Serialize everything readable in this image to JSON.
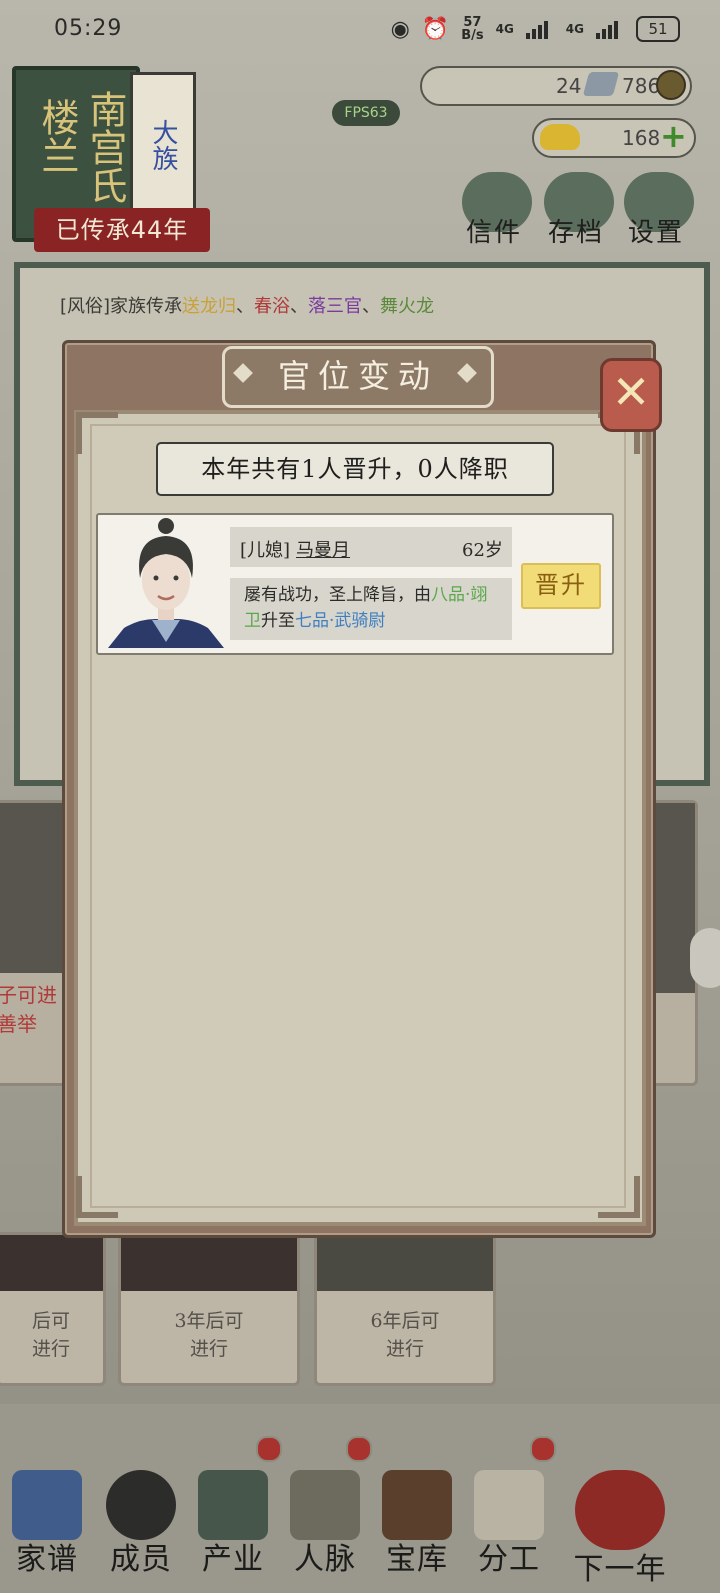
{
  "status_bar": {
    "time": "05:29",
    "net_speed_top": "57",
    "net_speed_unit": "B/s",
    "network_1": "4G",
    "network_2": "4G",
    "battery": "51"
  },
  "clan": {
    "book_left": "楼兰",
    "book_main": "南宫氏",
    "book_badge": "大族",
    "inheritance": "已传承44年"
  },
  "fps": "FPS63",
  "resources": {
    "item_count": "24",
    "coins": "786",
    "gold_ingot": "168"
  },
  "top_menu": [
    {
      "label": "信件"
    },
    {
      "label": "存档"
    },
    {
      "label": "设置"
    }
  ],
  "news": {
    "line1_prefix": "[风俗]家族传承",
    "customs": [
      "送龙归",
      "春浴",
      "落三官",
      "舞火龙"
    ],
    "customs_colors": [
      "#c9a136",
      "#b03a3a",
      "#7a3aa0",
      "#5a8a3a"
    ],
    "separator": "、"
  },
  "background_cards": {
    "side_left_text_1": "子可进",
    "side_left_text_2": "善举",
    "bottom": [
      {
        "line1": "后可",
        "line2": "进行"
      },
      {
        "line1": "3年后可",
        "line2": "进行"
      },
      {
        "line1": "6年后可",
        "line2": "进行"
      }
    ]
  },
  "bottom_nav": [
    {
      "label": "家谱"
    },
    {
      "label": "成员"
    },
    {
      "label": "产业"
    },
    {
      "label": "人脉"
    },
    {
      "label": "宝库"
    },
    {
      "label": "分工"
    },
    {
      "label": "下一年"
    }
  ],
  "modal": {
    "title": "官位变动",
    "summary": "本年共有1人晋升，0人降职",
    "records": [
      {
        "role_tag": "[儿媳]",
        "name": "马曼月",
        "age": "62岁",
        "desc_prefix": "屡有战功，圣上降旨，由",
        "from_rank": "八品·翊卫",
        "desc_mid": "升至",
        "to_rank": "七品·武骑尉",
        "from_color": "#5aa84a",
        "to_color": "#3f7fc0",
        "status": "晋升"
      }
    ]
  },
  "icons": {
    "close": "close-icon",
    "gold": "gold-ingot-icon",
    "silver": "silver-ingot-icon",
    "coin": "coin-icon",
    "plus": "plus-icon",
    "eye": "eye-icon",
    "alarm": "alarm-icon"
  }
}
